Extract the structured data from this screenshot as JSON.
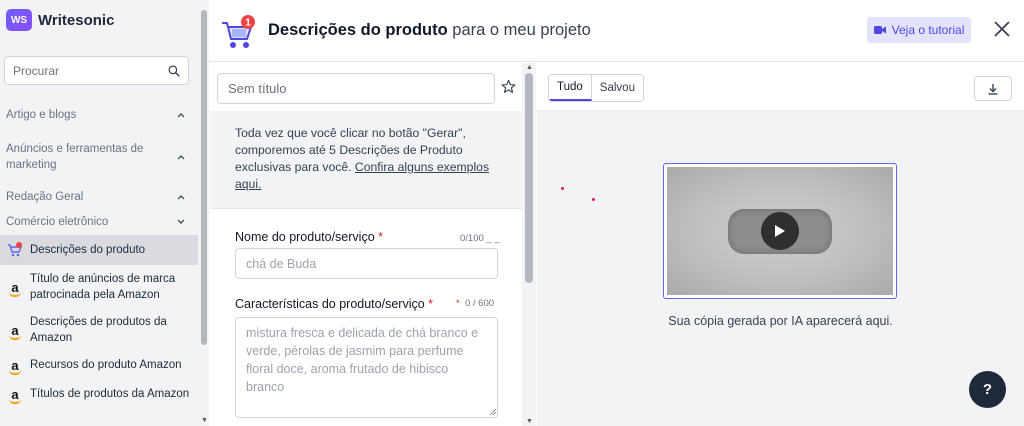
{
  "brand": {
    "logo_text": "WS",
    "name": "Writesonic"
  },
  "sidebar": {
    "search_placeholder": "Procurar",
    "sections": [
      {
        "label": "Artigo e blogs",
        "state": "collapsed"
      },
      {
        "label": "Anúncios e ferramentas de marketing",
        "state": "collapsed"
      },
      {
        "label": "Redação Geral",
        "state": "collapsed"
      },
      {
        "label": "Comércio eletrônico",
        "state": "expanded"
      }
    ],
    "items": [
      {
        "label": "Descrições do produto",
        "icon": "cart-icon",
        "active": true
      },
      {
        "label": "Título de anúncios de marca patrocinada pela Amazon",
        "icon": "amazon-icon",
        "active": false
      },
      {
        "label": "Descrições de produtos da Amazon",
        "icon": "amazon-icon",
        "active": false
      },
      {
        "label": "Recursos do produto Amazon",
        "icon": "amazon-icon",
        "active": false
      },
      {
        "label": "Títulos de produtos da Amazon",
        "icon": "amazon-icon",
        "active": false
      }
    ]
  },
  "header": {
    "icon_badge": "1",
    "title_bold": "Descrições do produto",
    "title_rest": " para o meu projeto",
    "tutorial_label": "Veja o tutorial"
  },
  "form": {
    "title_placeholder": "Sem título",
    "info_text": "Toda vez que você clicar no botão \"Gerar\", comporemos até 5 Descrições de Produto exclusivas para você. ",
    "info_link": "Confira alguns exemplos aqui.",
    "name_label": "Nome do produto/serviço",
    "name_counter": "0/100",
    "name_placeholder": "chá de Buda",
    "features_label": "Características do produto/serviço",
    "features_counter": "0 / 600",
    "features_placeholder": "mistura fresca e delicada de chá branco e verde, pérolas de jasmim para perfume floral doce, aroma frutado de hibisco branco",
    "required_mark": "*"
  },
  "output": {
    "tabs": [
      {
        "label": "Tudo",
        "active": true
      },
      {
        "label": "Salvou",
        "active": false
      }
    ],
    "empty_text": "Sua cópia gerada por IA aparecerá aqui.",
    "help_label": "?"
  },
  "colors": {
    "accent": "#4f46e5",
    "tutorial_bg": "#e4e3fd",
    "help_bg": "#1e293b",
    "required": "#dc2626"
  }
}
